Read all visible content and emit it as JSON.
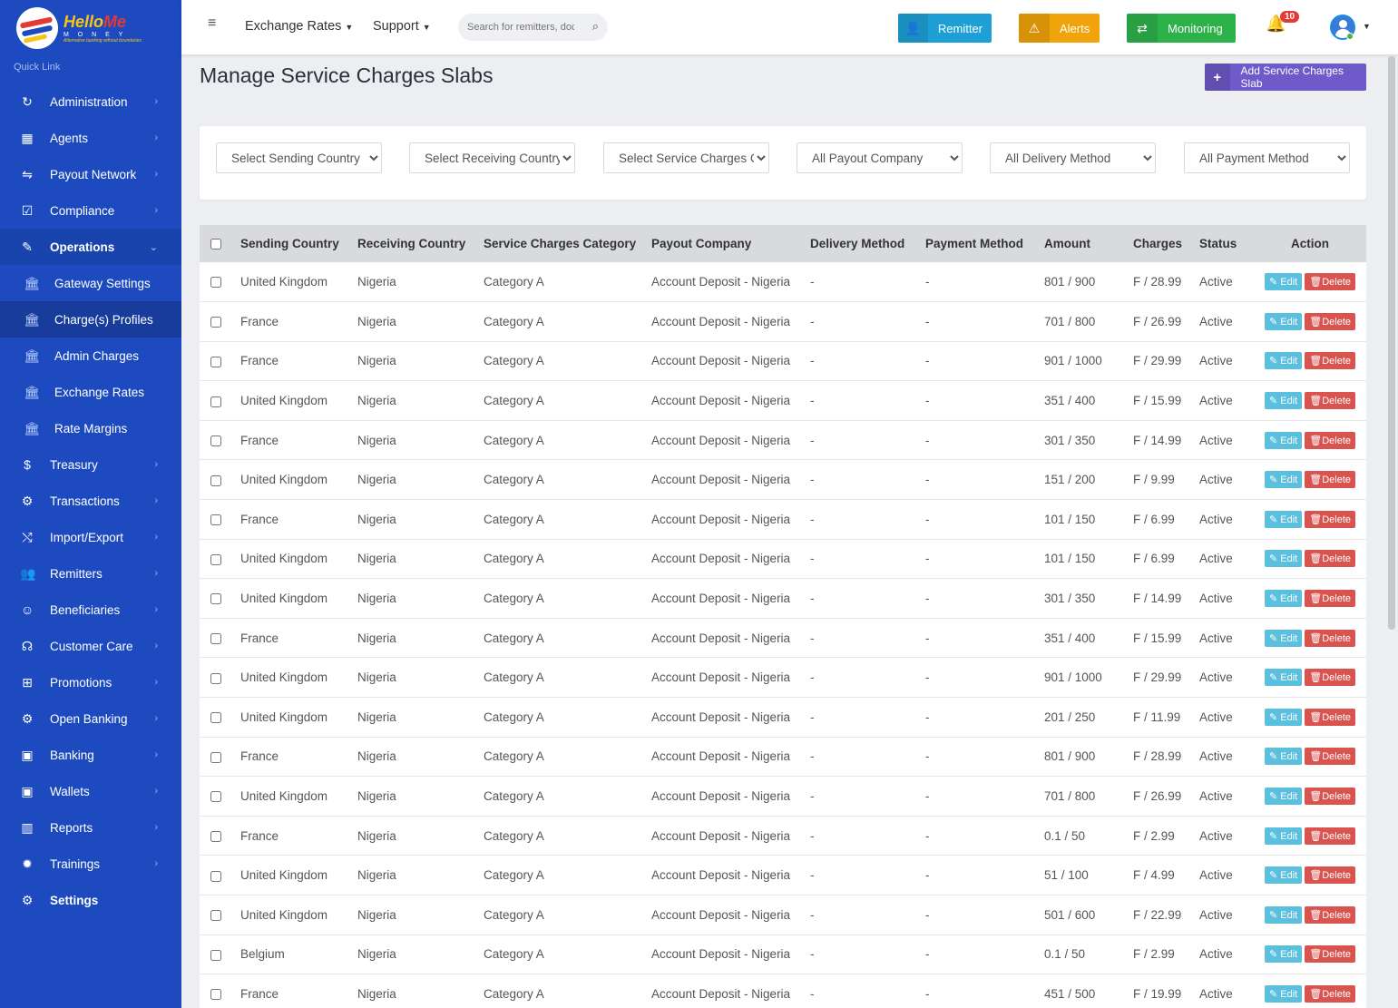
{
  "brand": {
    "name_a": "Hello",
    "name_b": "Me",
    "sub": "M O N E Y",
    "tagline": "Alternative banking without boundaries"
  },
  "sidebar": {
    "quick_link": "Quick Link",
    "items": [
      {
        "label": "Administration",
        "icon": "refresh-icon"
      },
      {
        "label": "Agents",
        "icon": "building-icon"
      },
      {
        "label": "Payout Network",
        "icon": "handshake-icon"
      },
      {
        "label": "Compliance",
        "icon": "check-square-icon"
      },
      {
        "label": "Operations",
        "icon": "wrench-icon"
      }
    ],
    "sub_items": [
      {
        "label": "Gateway Settings"
      },
      {
        "label": "Charge(s) Profiles"
      },
      {
        "label": "Admin Charges"
      },
      {
        "label": "Exchange Rates"
      },
      {
        "label": "Rate Margins"
      }
    ],
    "items_after": [
      {
        "label": "Treasury"
      },
      {
        "label": "Transactions"
      },
      {
        "label": "Import/Export"
      },
      {
        "label": "Remitters"
      },
      {
        "label": "Beneficiaries"
      },
      {
        "label": "Customer Care"
      },
      {
        "label": "Promotions"
      },
      {
        "label": "Open Banking"
      },
      {
        "label": "Banking"
      },
      {
        "label": "Wallets"
      },
      {
        "label": "Reports"
      },
      {
        "label": "Trainings"
      },
      {
        "label": "Settings"
      }
    ]
  },
  "topbar": {
    "menu_exchange": "Exchange Rates",
    "menu_support": "Support",
    "search_placeholder": "Search for remitters, docs",
    "btn_remitter": "Remitter",
    "btn_alerts": "Alerts",
    "btn_monitoring": "Monitoring",
    "notif_count": "10"
  },
  "page": {
    "title": "Manage Service Charges Slabs",
    "add_button": "Add Service Charges Slab"
  },
  "filters": {
    "sending": "Select Sending Country",
    "receiving": "Select Receiving Country",
    "category": "Select Service Charges Category",
    "payout": "All Payout Company",
    "delivery": "All Delivery Method",
    "payment": "All Payment Method"
  },
  "table": {
    "headers": {
      "sending": "Sending Country",
      "receiving": "Receiving Country",
      "category": "Service Charges Category",
      "payout": "Payout Company",
      "delivery": "Delivery Method",
      "payment": "Payment Method",
      "amount": "Amount",
      "charges": "Charges",
      "status": "Status",
      "action": "Action"
    },
    "edit_label": "Edit",
    "delete_label": "Delete",
    "rows": [
      {
        "sending": "United Kingdom",
        "receiving": "Nigeria",
        "category": "Category A",
        "payout": "Account Deposit - Nigeria",
        "delivery": "-",
        "payment": "-",
        "amount": "801 / 900",
        "charges": "F / 28.99",
        "status": "Active"
      },
      {
        "sending": "France",
        "receiving": "Nigeria",
        "category": "Category A",
        "payout": "Account Deposit - Nigeria",
        "delivery": "-",
        "payment": "-",
        "amount": "701 / 800",
        "charges": "F / 26.99",
        "status": "Active"
      },
      {
        "sending": "France",
        "receiving": "Nigeria",
        "category": "Category A",
        "payout": "Account Deposit - Nigeria",
        "delivery": "-",
        "payment": "-",
        "amount": "901 / 1000",
        "charges": "F / 29.99",
        "status": "Active"
      },
      {
        "sending": "United Kingdom",
        "receiving": "Nigeria",
        "category": "Category A",
        "payout": "Account Deposit - Nigeria",
        "delivery": "-",
        "payment": "-",
        "amount": "351 / 400",
        "charges": "F / 15.99",
        "status": "Active"
      },
      {
        "sending": "France",
        "receiving": "Nigeria",
        "category": "Category A",
        "payout": "Account Deposit - Nigeria",
        "delivery": "-",
        "payment": "-",
        "amount": "301 / 350",
        "charges": "F / 14.99",
        "status": "Active"
      },
      {
        "sending": "United Kingdom",
        "receiving": "Nigeria",
        "category": "Category A",
        "payout": "Account Deposit - Nigeria",
        "delivery": "-",
        "payment": "-",
        "amount": "151 / 200",
        "charges": "F / 9.99",
        "status": "Active"
      },
      {
        "sending": "France",
        "receiving": "Nigeria",
        "category": "Category A",
        "payout": "Account Deposit - Nigeria",
        "delivery": "-",
        "payment": "-",
        "amount": "101 / 150",
        "charges": "F / 6.99",
        "status": "Active"
      },
      {
        "sending": "United Kingdom",
        "receiving": "Nigeria",
        "category": "Category A",
        "payout": "Account Deposit - Nigeria",
        "delivery": "-",
        "payment": "-",
        "amount": "101 / 150",
        "charges": "F / 6.99",
        "status": "Active"
      },
      {
        "sending": "United Kingdom",
        "receiving": "Nigeria",
        "category": "Category A",
        "payout": "Account Deposit - Nigeria",
        "delivery": "-",
        "payment": "-",
        "amount": "301 / 350",
        "charges": "F / 14.99",
        "status": "Active"
      },
      {
        "sending": "France",
        "receiving": "Nigeria",
        "category": "Category A",
        "payout": "Account Deposit - Nigeria",
        "delivery": "-",
        "payment": "-",
        "amount": "351 / 400",
        "charges": "F / 15.99",
        "status": "Active"
      },
      {
        "sending": "United Kingdom",
        "receiving": "Nigeria",
        "category": "Category A",
        "payout": "Account Deposit - Nigeria",
        "delivery": "-",
        "payment": "-",
        "amount": "901 / 1000",
        "charges": "F / 29.99",
        "status": "Active"
      },
      {
        "sending": "United Kingdom",
        "receiving": "Nigeria",
        "category": "Category A",
        "payout": "Account Deposit - Nigeria",
        "delivery": "-",
        "payment": "-",
        "amount": "201 / 250",
        "charges": "F / 11.99",
        "status": "Active"
      },
      {
        "sending": "France",
        "receiving": "Nigeria",
        "category": "Category A",
        "payout": "Account Deposit - Nigeria",
        "delivery": "-",
        "payment": "-",
        "amount": "801 / 900",
        "charges": "F / 28.99",
        "status": "Active"
      },
      {
        "sending": "United Kingdom",
        "receiving": "Nigeria",
        "category": "Category A",
        "payout": "Account Deposit - Nigeria",
        "delivery": "-",
        "payment": "-",
        "amount": "701 / 800",
        "charges": "F / 26.99",
        "status": "Active"
      },
      {
        "sending": "France",
        "receiving": "Nigeria",
        "category": "Category A",
        "payout": "Account Deposit - Nigeria",
        "delivery": "-",
        "payment": "-",
        "amount": "0.1 / 50",
        "charges": "F / 2.99",
        "status": "Active"
      },
      {
        "sending": "United Kingdom",
        "receiving": "Nigeria",
        "category": "Category A",
        "payout": "Account Deposit - Nigeria",
        "delivery": "-",
        "payment": "-",
        "amount": "51 / 100",
        "charges": "F / 4.99",
        "status": "Active"
      },
      {
        "sending": "United Kingdom",
        "receiving": "Nigeria",
        "category": "Category A",
        "payout": "Account Deposit - Nigeria",
        "delivery": "-",
        "payment": "-",
        "amount": "501 / 600",
        "charges": "F / 22.99",
        "status": "Active"
      },
      {
        "sending": "Belgium",
        "receiving": "Nigeria",
        "category": "Category A",
        "payout": "Account Deposit - Nigeria",
        "delivery": "-",
        "payment": "-",
        "amount": "0.1 / 50",
        "charges": "F / 2.99",
        "status": "Active"
      },
      {
        "sending": "France",
        "receiving": "Nigeria",
        "category": "Category A",
        "payout": "Account Deposit - Nigeria",
        "delivery": "-",
        "payment": "-",
        "amount": "451 / 500",
        "charges": "F / 19.99",
        "status": "Active"
      }
    ]
  },
  "colors": {
    "sidebar": "#1d4bbf",
    "remitter": "#1ea0d6",
    "alerts": "#f0a30a",
    "monitoring": "#2db24a",
    "add": "#6f5ac9",
    "edit": "#5bc0de",
    "delete": "#d9534f"
  }
}
